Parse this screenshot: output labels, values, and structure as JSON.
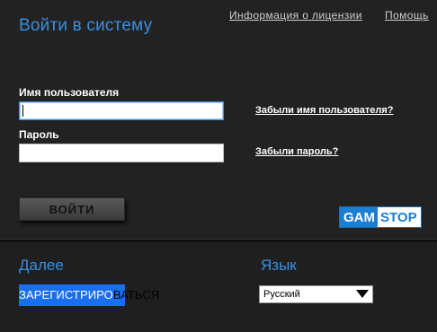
{
  "header": {
    "title": "Войти в систему",
    "license_link": "Информация о лицензии",
    "help_link": "Помощь"
  },
  "login_form": {
    "username_label": "Имя пользователя",
    "username_value": "",
    "password_label": "Пароль",
    "password_value": "",
    "forgot_username": "Забыли имя пользователя?",
    "forgot_password": "Забыли пароль?",
    "login_button": "ВОЙТИ"
  },
  "gamstop": {
    "gam": "GAM",
    "stop": "STOP",
    "icon": "gamstop-logo"
  },
  "next_section": {
    "title": "Далее",
    "register_highlighted": "ЗАРЕГИСТРИРО",
    "register_rest": "ВАТЬСЯ"
  },
  "language_section": {
    "title": "Язык",
    "selected": "Русский",
    "icon": "dropdown-arrow-icon"
  },
  "colors": {
    "accent": "#3a8fe0",
    "register_highlight": "#1a6ff0",
    "gamstop_blue": "#1b7fd1"
  }
}
